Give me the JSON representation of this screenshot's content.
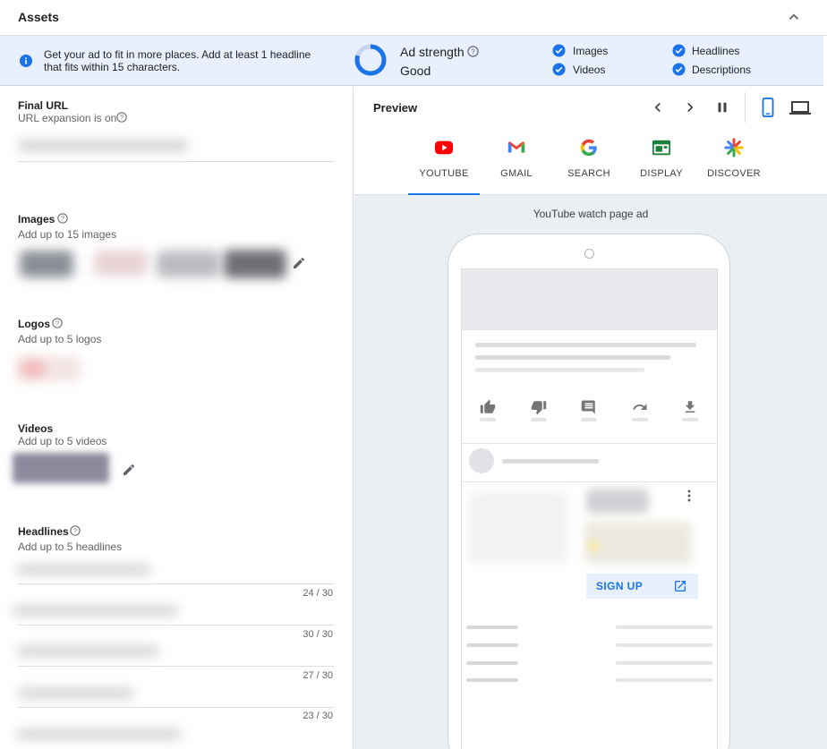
{
  "header": {
    "title": "Assets"
  },
  "banner": {
    "message": "Get your ad to fit in more places. Add at least 1 headline that fits within 15 characters.",
    "ad_strength_label": "Ad strength",
    "ad_strength_value": "Good",
    "ad_strength_fill": 0.8,
    "checks": [
      {
        "label": "Images"
      },
      {
        "label": "Videos"
      },
      {
        "label": "Headlines"
      },
      {
        "label": "Descriptions"
      }
    ],
    "colors": {
      "bg": "#e8f0fe",
      "accent": "#1a73e8"
    }
  },
  "sections": {
    "final_url": {
      "title": "Final URL",
      "subtitle": "URL expansion is on"
    },
    "images": {
      "title": "Images",
      "subtitle": "Add up to 15 images"
    },
    "logos": {
      "title": "Logos",
      "subtitle": "Add up to 5 logos"
    },
    "videos": {
      "title": "Videos",
      "subtitle": "Add up to 5 videos"
    },
    "headlines": {
      "title": "Headlines",
      "subtitle": "Add up to 5 headlines",
      "counts": [
        "24 / 30",
        "30 / 30",
        "27 / 30",
        "23 / 30"
      ]
    }
  },
  "preview": {
    "title": "Preview",
    "tabs": [
      {
        "label": "YOUTUBE",
        "icon": "youtube-icon"
      },
      {
        "label": "GMAIL",
        "icon": "gmail-icon"
      },
      {
        "label": "SEARCH",
        "icon": "google-icon"
      },
      {
        "label": "DISPLAY",
        "icon": "display-icon"
      },
      {
        "label": "DISCOVER",
        "icon": "discover-icon"
      }
    ],
    "active_tab": "YOUTUBE",
    "caption": "YouTube watch page ad",
    "cta": "SIGN UP"
  }
}
